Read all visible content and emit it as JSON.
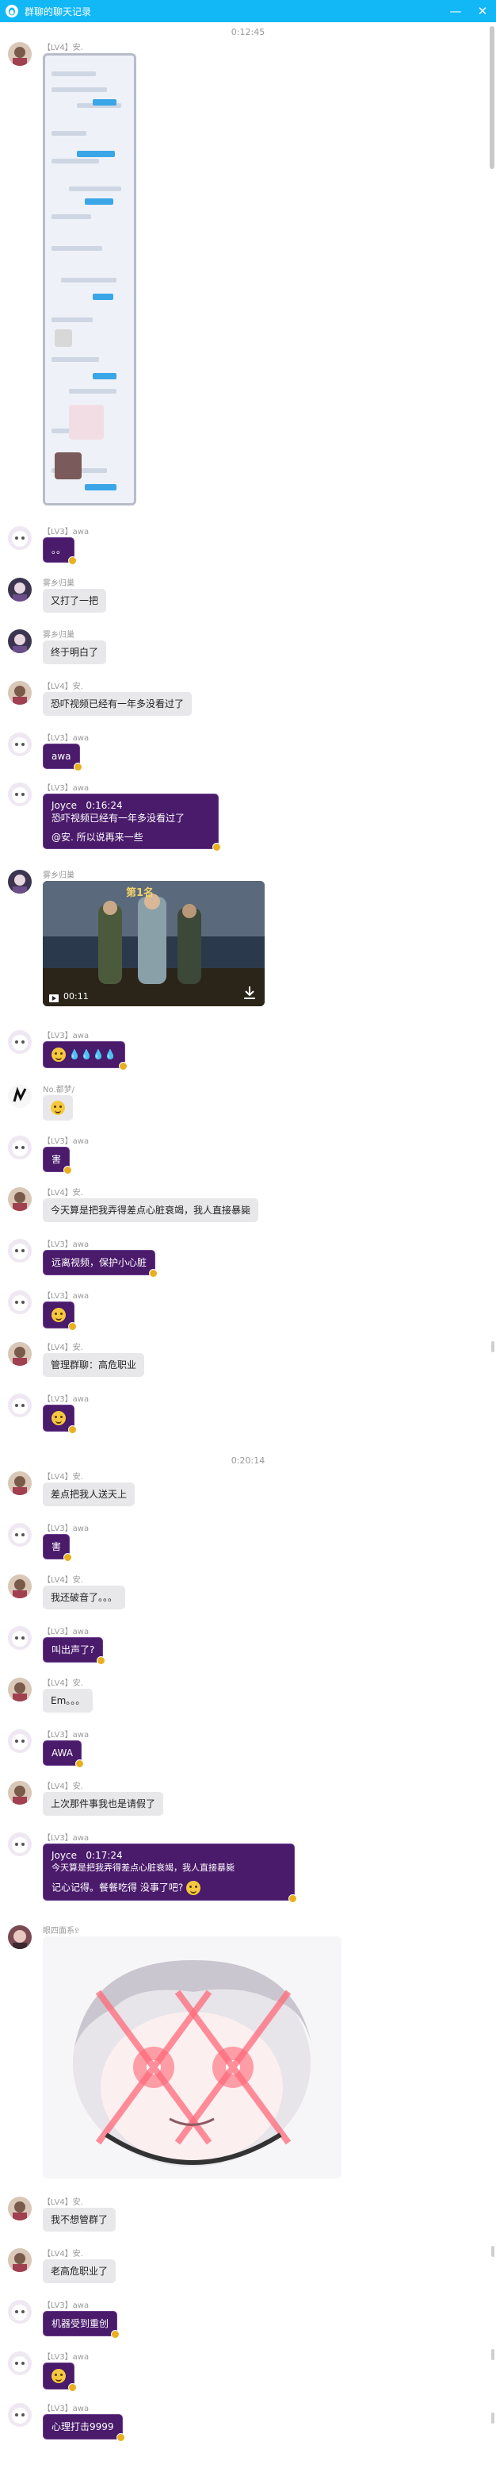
{
  "window": {
    "title": "群聊的聊天记录",
    "minimize": "—",
    "close": "✕"
  },
  "timestamps": [
    "0:12:45",
    "0:20:14"
  ],
  "messages": [
    {
      "sender": "【LV4】安.",
      "content": ""
    },
    {
      "sender": "【LV3】awa",
      "content": "。。"
    },
    {
      "sender": "雾乡归巢",
      "content": "又打了一把"
    },
    {
      "sender": "雾乡归巢",
      "content": "终于明白了"
    },
    {
      "sender": "【LV4】安.",
      "content": "恐吓视频已经有一年多没看过了"
    },
    {
      "sender": "【LV3】awa",
      "content": "awa"
    },
    {
      "sender": "【LV3】awa",
      "quote_author": "Joyce",
      "quote_time": "0:16:24",
      "quote_text": "恐吓视频已经有一年多没看过了",
      "content": "@安. 所以说再来一些"
    },
    {
      "sender": "雾乡归巢",
      "video": {
        "duration": "00:11",
        "banner_text": "第1名"
      }
    },
    {
      "sender": "【LV3】awa",
      "content": "💧💧💧💧"
    },
    {
      "sender": "No.都梦/",
      "content": ""
    },
    {
      "sender": "【LV3】awa",
      "content": "害"
    },
    {
      "sender": "【LV4】安.",
      "content": "今天算是把我弄得差点心脏衰竭，我人直接暴毙"
    },
    {
      "sender": "【LV3】awa",
      "content": "远离视频，保护小心脏"
    },
    {
      "sender": "【LV3】awa",
      "content": ""
    },
    {
      "sender": "【LV4】安.",
      "content": "管理群聊：高危职业"
    },
    {
      "sender": "【LV3】awa",
      "content": ""
    },
    {
      "sender": "【LV4】安.",
      "content": "差点把我人送天上"
    },
    {
      "sender": "【LV3】awa",
      "content": "害"
    },
    {
      "sender": "【LV4】安.",
      "content": "我还破音了。。。"
    },
    {
      "sender": "【LV3】awa",
      "content": "叫出声了?"
    },
    {
      "sender": "【LV4】安.",
      "content": "Em。。。"
    },
    {
      "sender": "【LV3】awa",
      "content": "AWA"
    },
    {
      "sender": "【LV4】安.",
      "content": "上次那件事我也是请假了"
    },
    {
      "sender": "【LV3】awa",
      "quote_author": "Joyce",
      "quote_time": "0:17:24",
      "quote_text": "今天算是把我弄得差点心脏衰竭，我人直接暴毙",
      "content": "记心记得。餐餐吃得 没事了吧?"
    },
    {
      "sender": "眼四面系𝔏",
      "content": ""
    },
    {
      "sender": "【LV4】安.",
      "content": "我不想管群了"
    },
    {
      "sender": "【LV4】安.",
      "content": "老高危职业了"
    },
    {
      "sender": "【LV3】awa",
      "content": "机器受到重创"
    },
    {
      "sender": "【LV3】awa",
      "content": ""
    },
    {
      "sender": "【LV3】awa",
      "content": "心理打击9999"
    }
  ],
  "colors": {
    "titlebar": "#12b7f5",
    "purple_bubble": "#4a1a6b",
    "grey_bubble": "#e8e8ea"
  },
  "icons": [
    "qq-penguin-icon",
    "minimize-icon",
    "close-icon",
    "play-icon",
    "download-icon",
    "emoji-face-icon"
  ]
}
